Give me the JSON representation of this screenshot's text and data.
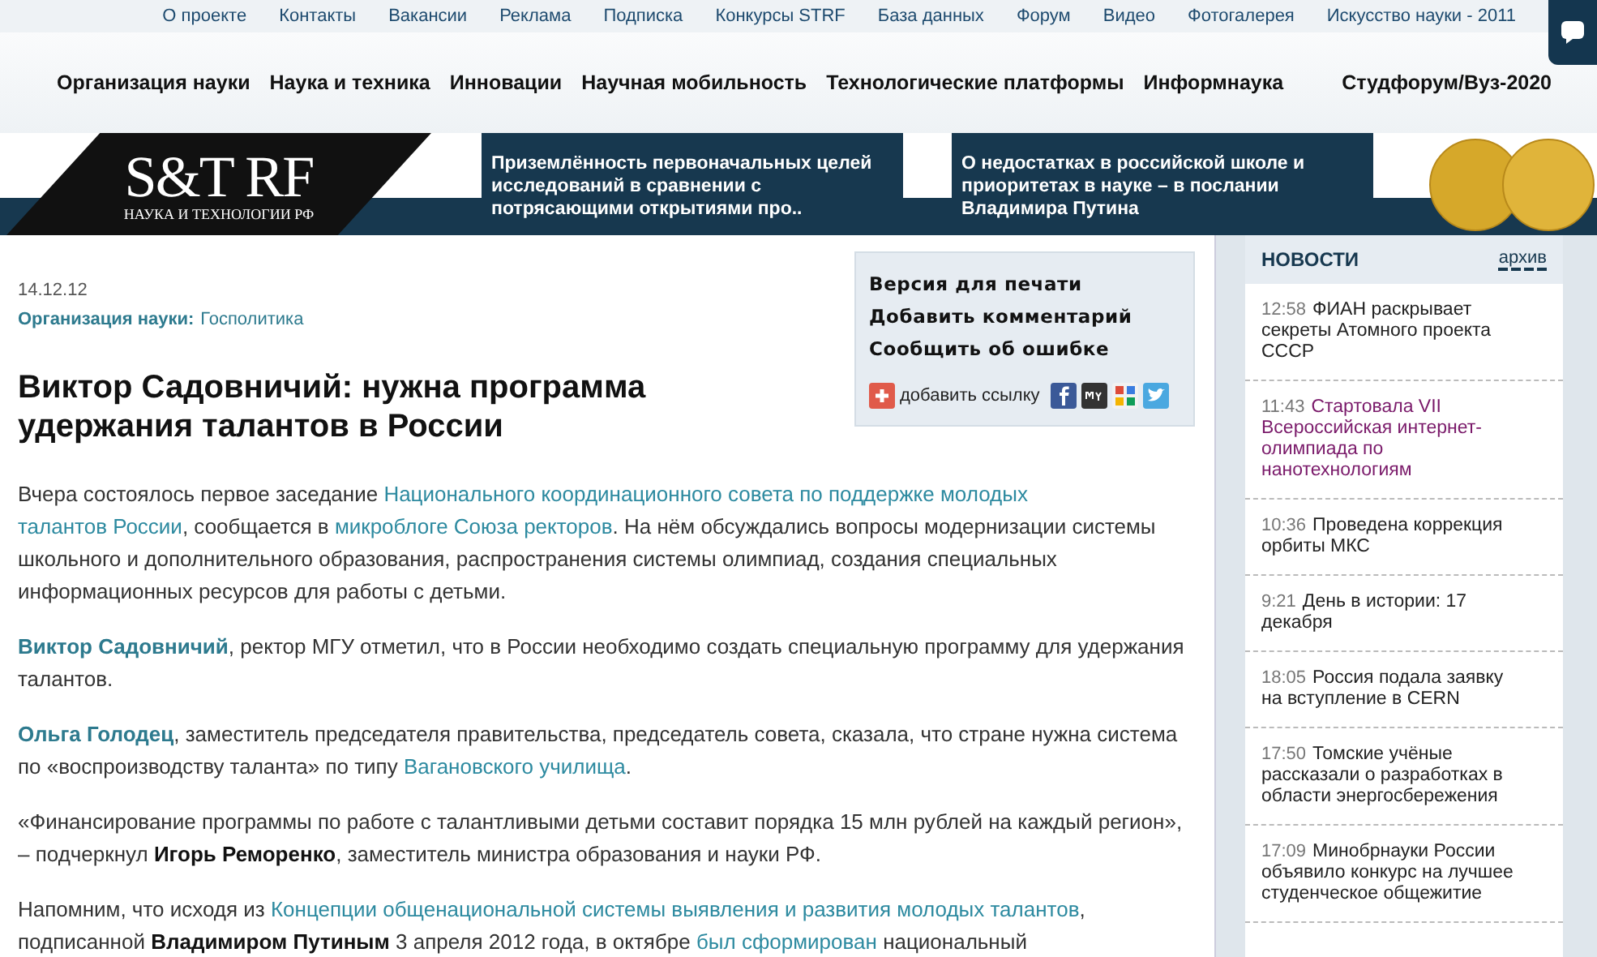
{
  "top_links": [
    "О проекте",
    "Контакты",
    "Вакансии",
    "Реклама",
    "Подписка",
    "Конкурсы STRF",
    "База данных",
    "Форум",
    "Видео",
    "Фотогалерея",
    "Искусство науки - 2011"
  ],
  "main_nav": [
    "Организация науки",
    "Наука и техника",
    "Инновации",
    "Научная мобильность",
    "Технологические платформы",
    "Информнаука",
    "Студфорум/Вуз-2020"
  ],
  "logo": {
    "name": "S&T RF",
    "tagline": "НАУКА И ТЕХНОЛОГИИ РФ"
  },
  "promos": [
    "Приземлённость первоначальных целей исследований в сравнении с потрясающими открытиями про..",
    "О недостатках в российской школе и приоритетах в науке – в послании Владимира Путина"
  ],
  "article": {
    "date": "14.12.12",
    "rubric": "Организация науки:",
    "tag": "Госполитика",
    "title": "Виктор Садовничий: нужна программа удержания талантов в России",
    "paragraphs": [
      [
        {
          "kind": "plain",
          "text": "Вчера состоялось первое заседание "
        },
        {
          "kind": "link",
          "text": "Национального координационного совета по поддержке молодых"
        },
        {
          "kind": "link_continued",
          "text": "талантов России"
        },
        {
          "kind": "plain",
          "text": ", сообщается в "
        },
        {
          "kind": "link",
          "text": "микроблоге Союза ректоров"
        },
        {
          "kind": "plain",
          "text": ". На нём обсуждались вопросы модернизации системы школьного и дополнительного образования, распространения системы олимпиад, создания специальных информационных ресурсов для работы с детьми."
        }
      ],
      [
        {
          "kind": "bold_link",
          "text": "Виктор Садовничий"
        },
        {
          "kind": "plain",
          "text": ", ректор МГУ отметил, что в России необходимо создать специальную программу для удержания талантов."
        }
      ],
      [
        {
          "kind": "bold_link",
          "text": "Ольга Голодец"
        },
        {
          "kind": "plain",
          "text": ", заместитель председателя правительства, председатель совета, сказала, что стране нужна система по «воспроизводству таланта» по типу "
        },
        {
          "kind": "link",
          "text": "Вагановского училища"
        },
        {
          "kind": "plain",
          "text": "."
        }
      ],
      [
        {
          "kind": "plain",
          "text": "«Финансирование программы по работе с талантливыми детьми составит порядка 15 млн рублей на каждый регион», – подчеркнул "
        },
        {
          "kind": "bold",
          "text": "Игорь Реморенко"
        },
        {
          "kind": "plain",
          "text": ", заместитель министра образования и науки РФ."
        }
      ],
      [
        {
          "kind": "plain",
          "text": "Напомним, что исходя из "
        },
        {
          "kind": "link",
          "text": "Концепции общенациональной системы выявления и развития молодых талантов"
        },
        {
          "kind": "plain",
          "text": ", подписанной "
        },
        {
          "kind": "bold",
          "text": "Владимиром Путиным"
        },
        {
          "kind": "plain",
          "text": " 3 апреля 2012 года, в октябре "
        },
        {
          "kind": "link",
          "text": "был сформирован"
        },
        {
          "kind": "plain",
          "text": " национальный"
        }
      ]
    ]
  },
  "tools": {
    "links": [
      "Версия для печати",
      "Добавить комментарий",
      "Сообщить об ошибке"
    ],
    "share": "добавить ссылку"
  },
  "news": {
    "title": "НОВОСТИ",
    "archive": "архив",
    "items": [
      {
        "time": "12:58",
        "text": "ФИАН раскрывает секреты Атомного проекта СССР",
        "visited": false
      },
      {
        "time": "11:43",
        "text": "Стартовала VII Всероссийская интернет-олимпиада по нанотехнологиям",
        "visited": true
      },
      {
        "time": "10:36",
        "text": "Проведена коррекция орбиты МКС",
        "visited": false
      },
      {
        "time": "9:21",
        "text": "День в истории: 17 декабря",
        "visited": false
      },
      {
        "time": "18:05",
        "text": "Россия подала заявку на вступление в CERN",
        "visited": false
      },
      {
        "time": "17:50",
        "text": "Томские учёные рассказали о разработках в области энергосбережения",
        "visited": false
      },
      {
        "time": "17:09",
        "text": "Минобрнауки России объявило конкурс на лучшее студенческое общежитие",
        "visited": false
      }
    ]
  }
}
